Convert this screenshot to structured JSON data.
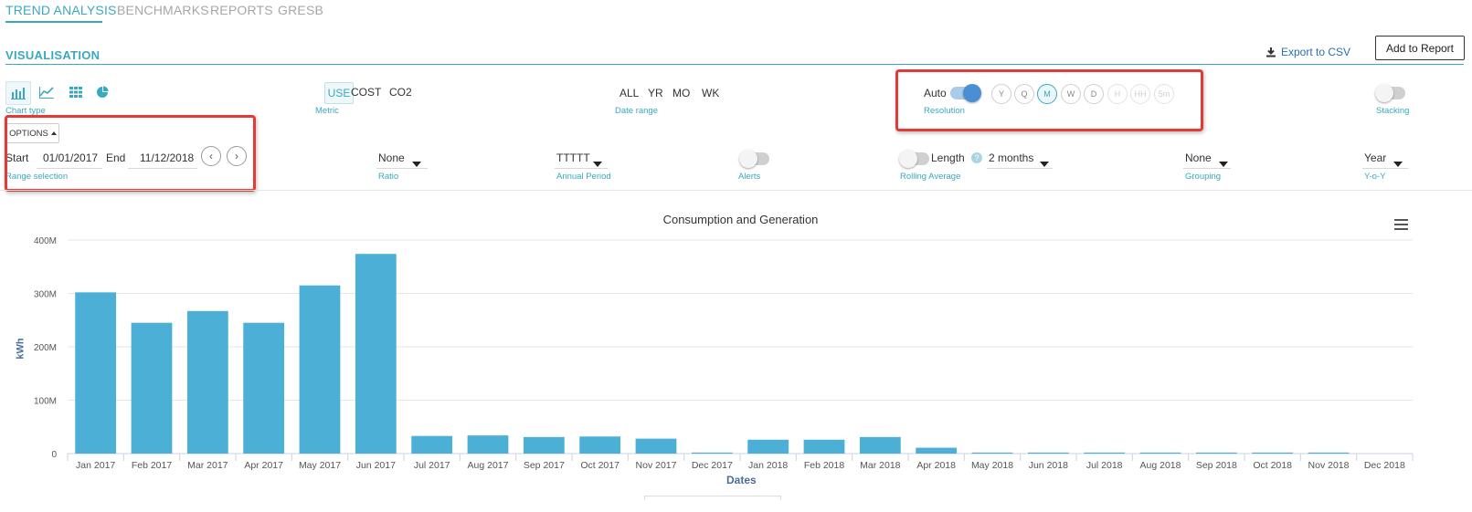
{
  "tabs": [
    "TREND ANALYSIS",
    "BENCHMARKS",
    "REPORTS",
    "GRESB"
  ],
  "section": {
    "title": "VISUALISATION",
    "export_label": "Export to CSV",
    "add_report_label": "Add to Report"
  },
  "controls": {
    "chart_type_label": "Chart type",
    "metric_options": [
      "USE",
      "COST",
      "CO2"
    ],
    "metric_selected": "USE",
    "metric_label": "Metric",
    "date_range_options": [
      "ALL",
      "YR",
      "MO",
      "WK"
    ],
    "date_range_label": "Date range",
    "auto_label": "Auto",
    "resolution_options": [
      "Y",
      "Q",
      "M",
      "W",
      "D",
      "H",
      "HH",
      "5m"
    ],
    "resolution_selected": "M",
    "resolution_label": "Resolution",
    "stacking_label": "Stacking"
  },
  "options": {
    "button_label": "OPTIONS",
    "start_label": "Start",
    "start_value": "01/01/2017",
    "end_label": "End",
    "end_value": "11/12/2018",
    "range_label": "Range selection",
    "ratio_value": "None",
    "ratio_label": "Ratio",
    "annual_value": "TTTTT",
    "annual_label": "Annual Period",
    "alerts_label": "Alerts",
    "length_label": "Length",
    "rolling_value": "2 months",
    "rolling_label": "Rolling Average",
    "grouping_value": "None",
    "grouping_label": "Grouping",
    "yoy_value": "Year",
    "yoy_label": "Y-o-Y"
  },
  "chart_data": {
    "type": "bar",
    "title": "Consumption and Generation",
    "xlabel": "Dates",
    "ylabel": "kWh",
    "ylim": [
      0,
      400
    ],
    "yticks": [
      "0",
      "100M",
      "200M",
      "300M",
      "400M"
    ],
    "categories": [
      "Jan 2017",
      "Feb 2017",
      "Mar 2017",
      "Apr 2017",
      "May 2017",
      "Jun 2017",
      "Jul 2017",
      "Aug 2017",
      "Sep 2017",
      "Oct 2017",
      "Nov 2017",
      "Dec 2017",
      "Jan 2018",
      "Feb 2018",
      "Mar 2018",
      "Apr 2018",
      "May 2018",
      "Jun 2018",
      "Jul 2018",
      "Aug 2018",
      "Sep 2018",
      "Oct 2018",
      "Nov 2018",
      "Dec 2018"
    ],
    "series": [
      {
        "values": [
          302,
          245,
          267,
          245,
          315,
          374,
          33,
          34,
          31,
          32,
          28,
          2,
          26,
          26,
          31,
          11,
          2,
          2,
          2,
          2,
          2,
          2,
          2,
          0
        ]
      }
    ],
    "color": "#4bafd6",
    "grid": true
  }
}
